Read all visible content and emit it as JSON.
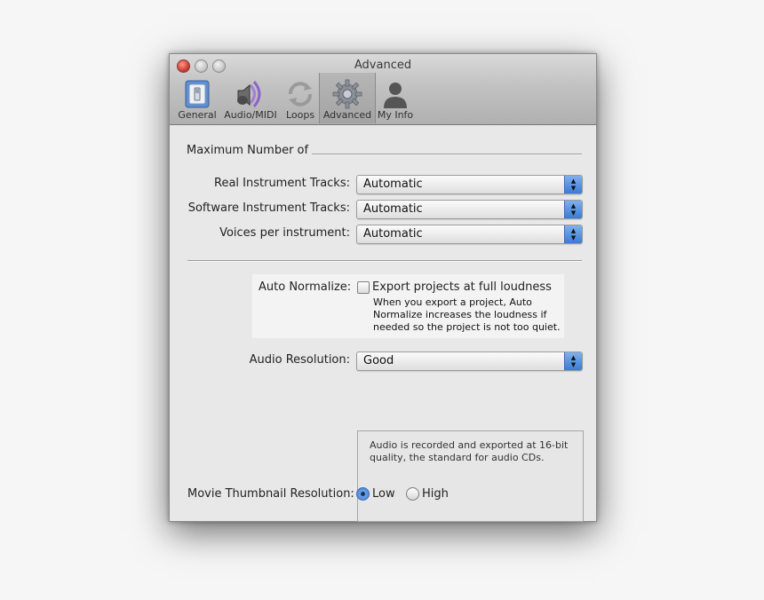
{
  "window": {
    "title": "Advanced"
  },
  "toolbar": {
    "items": [
      {
        "label": "General",
        "icon": "light-switch-icon"
      },
      {
        "label": "Audio/MIDI",
        "icon": "speaker-icon"
      },
      {
        "label": "Loops",
        "icon": "loop-arrows-icon"
      },
      {
        "label": "Advanced",
        "icon": "gear-icon",
        "selected": true
      },
      {
        "label": "My Info",
        "icon": "person-icon"
      }
    ]
  },
  "max_section": {
    "heading": "Maximum Number of",
    "rows": [
      {
        "label": "Real Instrument Tracks:",
        "value": "Automatic"
      },
      {
        "label": "Software Instrument Tracks:",
        "value": "Automatic"
      },
      {
        "label": "Voices per instrument:",
        "value": "Automatic"
      }
    ]
  },
  "auto_normalize": {
    "label": "Auto Normalize:",
    "checkbox_label": "Export projects at full loudness",
    "checked": false,
    "description": [
      "When you export a project, Auto",
      "Normalize increases the loudness if",
      "needed so the project is not too quiet."
    ]
  },
  "audio_resolution": {
    "label": "Audio Resolution:",
    "value": "Good",
    "description": [
      "Audio is recorded and exported at 16-bit",
      "quality, the standard for audio CDs."
    ]
  },
  "movie_thumbnail": {
    "label": "Movie Thumbnail Resolution:",
    "options": [
      {
        "label": "Low",
        "selected": true
      },
      {
        "label": "High",
        "selected": false
      }
    ]
  },
  "colors": {
    "accent": "#3a7bd6",
    "window_bg": "#e8e8e8"
  }
}
